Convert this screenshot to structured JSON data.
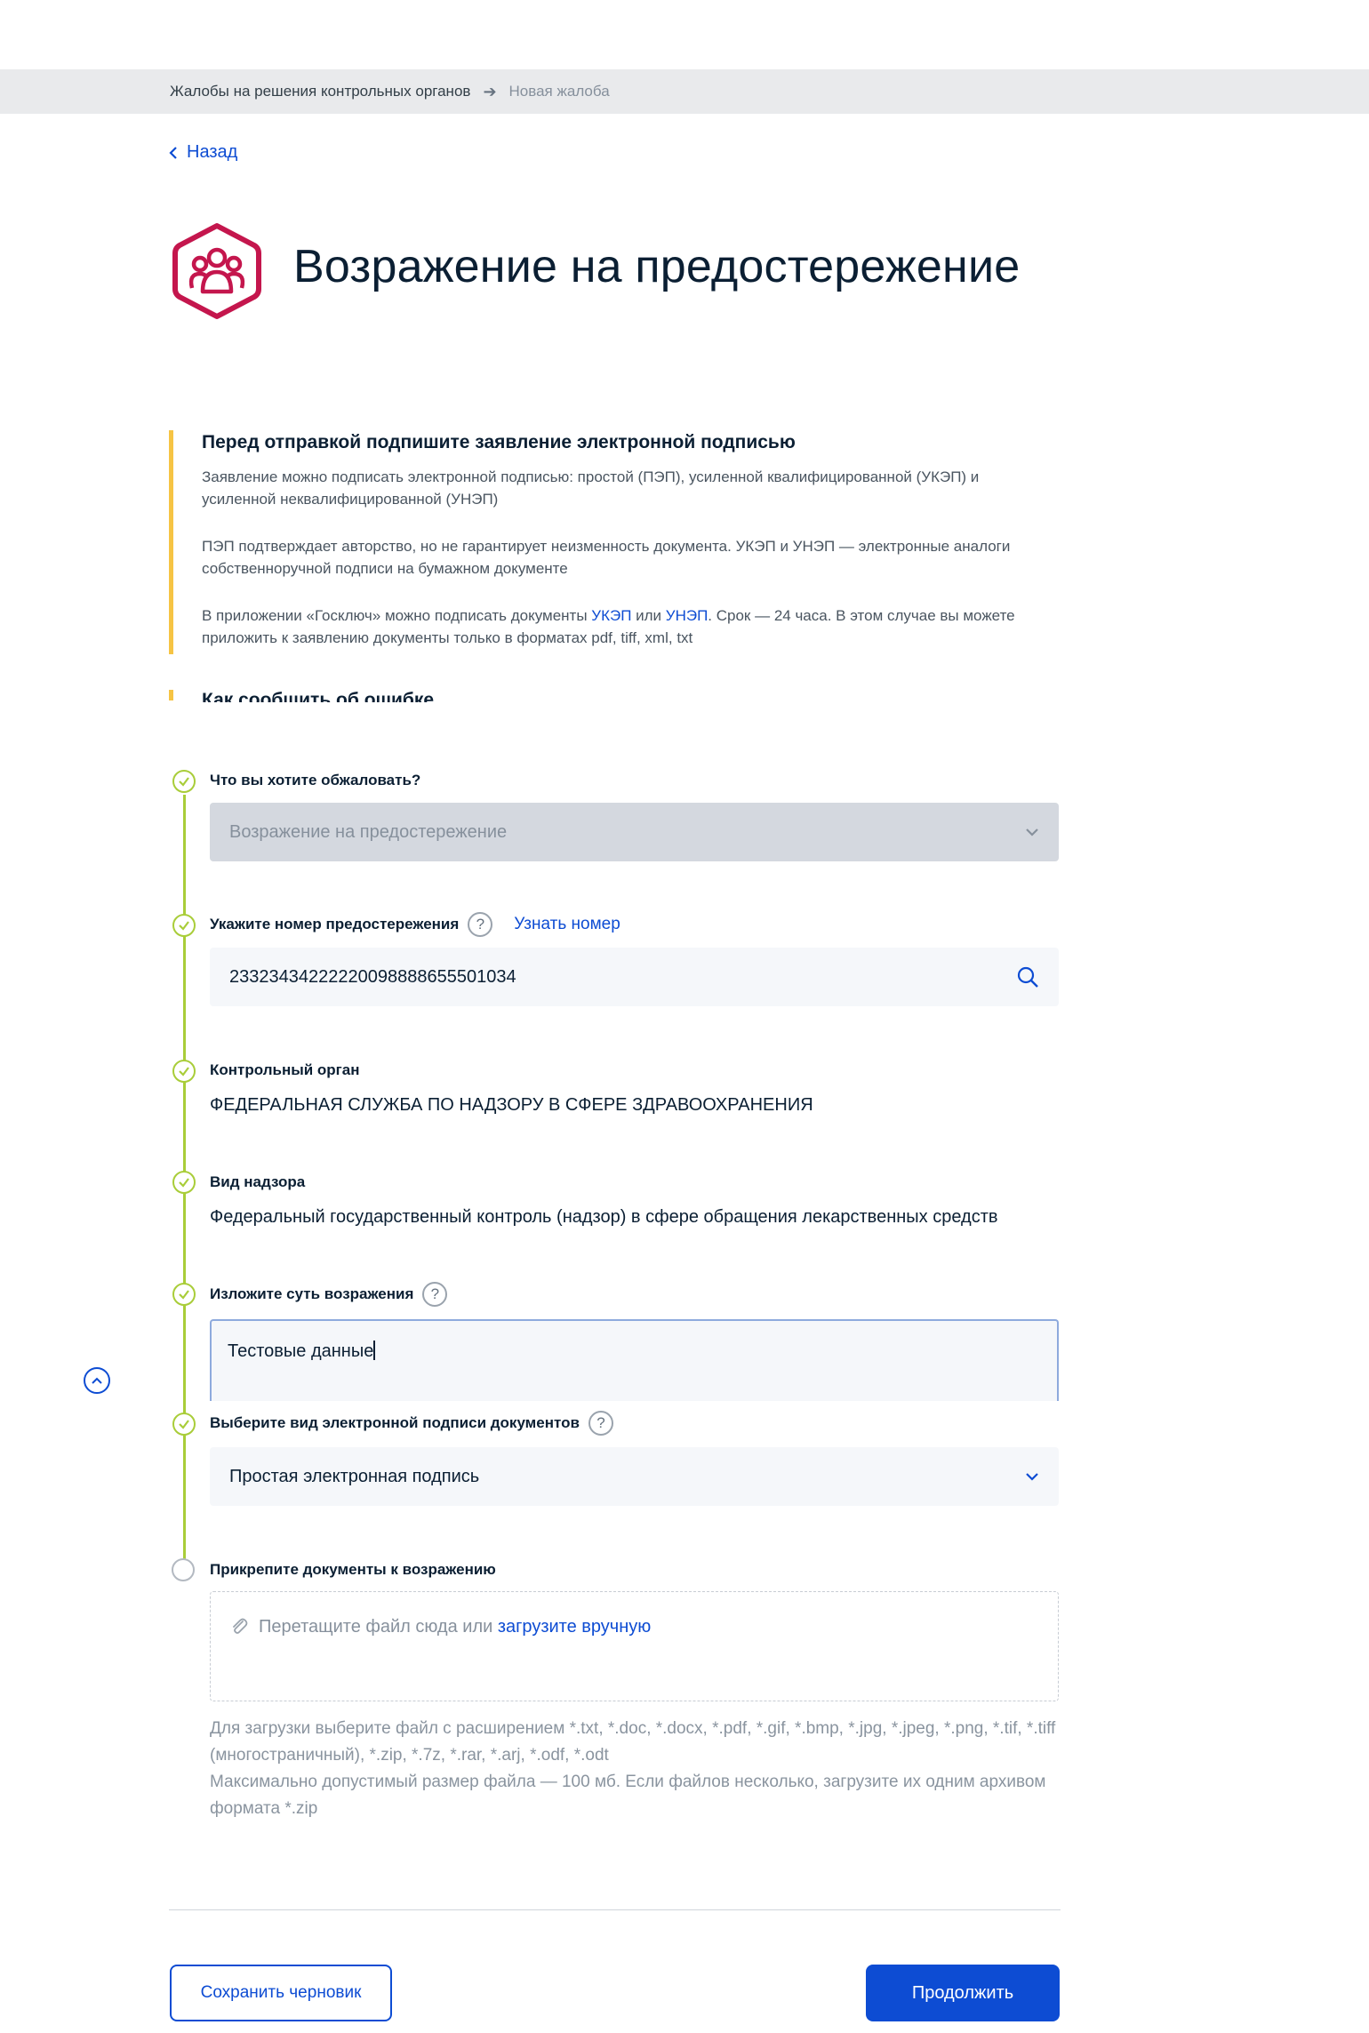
{
  "breadcrumb": {
    "parent": "Жалобы на решения контрольных органов",
    "current": "Новая жалоба"
  },
  "back_label": "Назад",
  "page_title": "Возражение на предостережение",
  "colors": {
    "accent": "#0d4cd3",
    "step": "#a9cd39",
    "warning": "#f6c444",
    "icon": "#c4164d"
  },
  "info": {
    "title": "Перед отправкой подпишите заявление электронной подписью",
    "p1": "Заявление можно подписать электронной подписью: простой (ПЭП), усиленной квалифицированной (УКЭП) и усиленной неквалифицированной (УНЭП)",
    "p2": "ПЭП подтверждает авторство, но не гарантирует неизменность документа. УКЭП и УНЭП — электронные аналоги собственноручной подписи на бумажном документе",
    "p3_before": "В приложении «Госключ» можно подписать документы ",
    "p3_link1": "УКЭП",
    "p3_mid": " или ",
    "p3_link2": "УНЭП",
    "p3_after": ". Срок — 24 часа. В этом случае вы можете приложить к заявлению документы только в форматах pdf, tiff, xml, txt"
  },
  "info2_title": "Как сообщить об ошибке",
  "steps": {
    "s1": {
      "label": "Что вы хотите обжаловать?",
      "value": "Возражение на предостережение"
    },
    "s2": {
      "label": "Укажите номер предостережения",
      "help": "?",
      "link": "Узнать номер",
      "value": "23323434222220098888655501034"
    },
    "s3": {
      "label": "Контрольный орган",
      "value": "ФЕДЕРАЛЬНАЯ СЛУЖБА ПО НАДЗОРУ В СФЕРЕ ЗДРАВООХРАНЕНИЯ"
    },
    "s4": {
      "label": "Вид надзора",
      "value": "Федеральный государственный контроль (надзор) в сфере обращения лекарственных средств"
    },
    "s5": {
      "label": "Изложите суть возражения",
      "help": "?",
      "value": "Тестовые данные"
    },
    "s6": {
      "label": "Выберите вид электронной подписи документов",
      "help": "?",
      "value": "Простая электронная подпись"
    },
    "s7": {
      "label": "Прикрепите документы к возражению"
    }
  },
  "upload": {
    "text": "Перетащите файл сюда или ",
    "link": "загрузите вручную",
    "hint1": "Для загрузки выберите файл с расширением *.txt, *.doc, *.docx, *.pdf, *.gif, *.bmp, *.jpg, *.jpeg, *.png, *.tif, *.tiff (многостраничный), *.zip, *.7z, *.rar, *.arj, *.odf, *.odt",
    "hint2": "Максимально допустимый размер файла — 100 мб. Если файлов несколько, загрузите их одним архивом формата *.zip"
  },
  "buttons": {
    "draft": "Сохранить черновик",
    "next": "Продолжить"
  }
}
